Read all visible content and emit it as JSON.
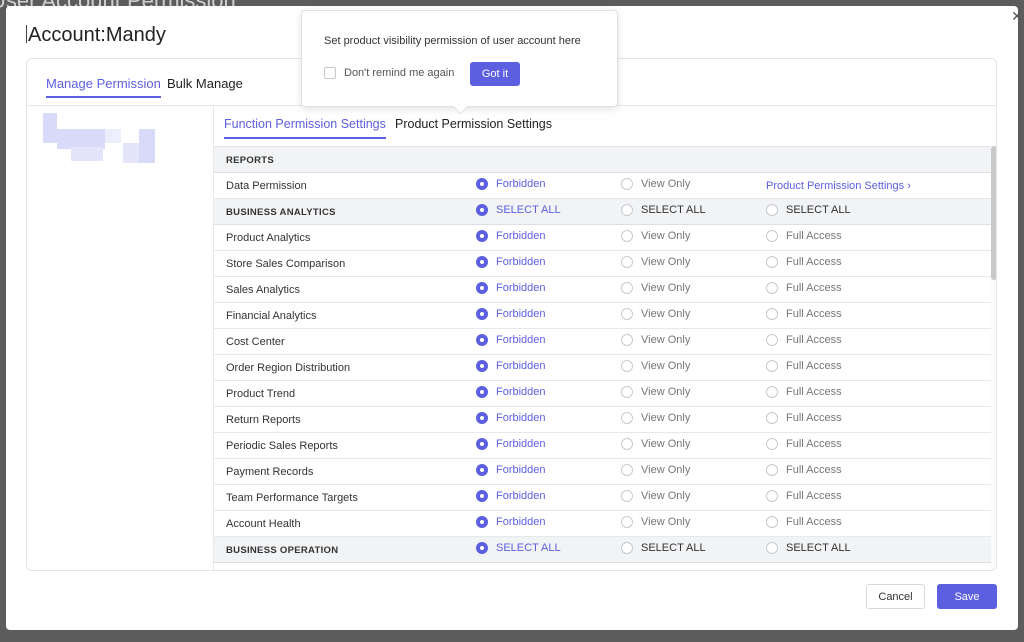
{
  "background": {
    "title": "User Account Permission"
  },
  "modal": {
    "account_title": "Account:Mandy",
    "close_icon": "close-icon",
    "top_tabs": [
      {
        "label": "Manage Permission",
        "active": true
      },
      {
        "label": "Bulk Manage",
        "active": false
      }
    ],
    "sub_tabs": [
      {
        "label": "Function Permission Settings",
        "active": true
      },
      {
        "label": "Product Permission Settings",
        "active": false
      }
    ],
    "table": {
      "sections": [
        {
          "title": "REPORTS",
          "rows": [
            {
              "label": "Data Permission",
              "opt1": "Forbidden",
              "opt2": "View Only",
              "link": "Product Permission Settings",
              "selected": 1
            }
          ]
        },
        {
          "title": "BUSINESS ANALYTICS",
          "select_all": [
            "SELECT ALL",
            "SELECT ALL",
            "SELECT ALL"
          ],
          "rows": [
            {
              "label": "Product Analytics",
              "selected": 1
            },
            {
              "label": "Store Sales Comparison",
              "selected": 1
            },
            {
              "label": "Sales Analytics",
              "selected": 1
            },
            {
              "label": "Financial Analytics",
              "selected": 1
            },
            {
              "label": "Cost Center",
              "selected": 1
            },
            {
              "label": "Order Region Distribution",
              "selected": 1
            },
            {
              "label": "Product Trend",
              "selected": 1
            },
            {
              "label": "Return Reports",
              "selected": 1
            },
            {
              "label": "Periodic Sales Reports",
              "selected": 1
            },
            {
              "label": "Payment Records",
              "selected": 1
            },
            {
              "label": "Team Performance Targets",
              "selected": 1
            },
            {
              "label": "Account Health",
              "selected": 1
            }
          ]
        },
        {
          "title": "BUSINESS OPERATION",
          "select_all": [
            "SELECT ALL",
            "SELECT ALL",
            "SELECT ALL"
          ],
          "rows": []
        }
      ],
      "options": [
        "Forbidden",
        "View Only",
        "Full Access"
      ],
      "colors": {
        "accent": "#5b5fe0"
      }
    },
    "tooltip": {
      "message": "Set product visibility permission of user account here",
      "remind_label": "Don't remind me again",
      "got_it_label": "Got it"
    },
    "footer": {
      "cancel_label": "Cancel",
      "save_label": "Save"
    }
  }
}
